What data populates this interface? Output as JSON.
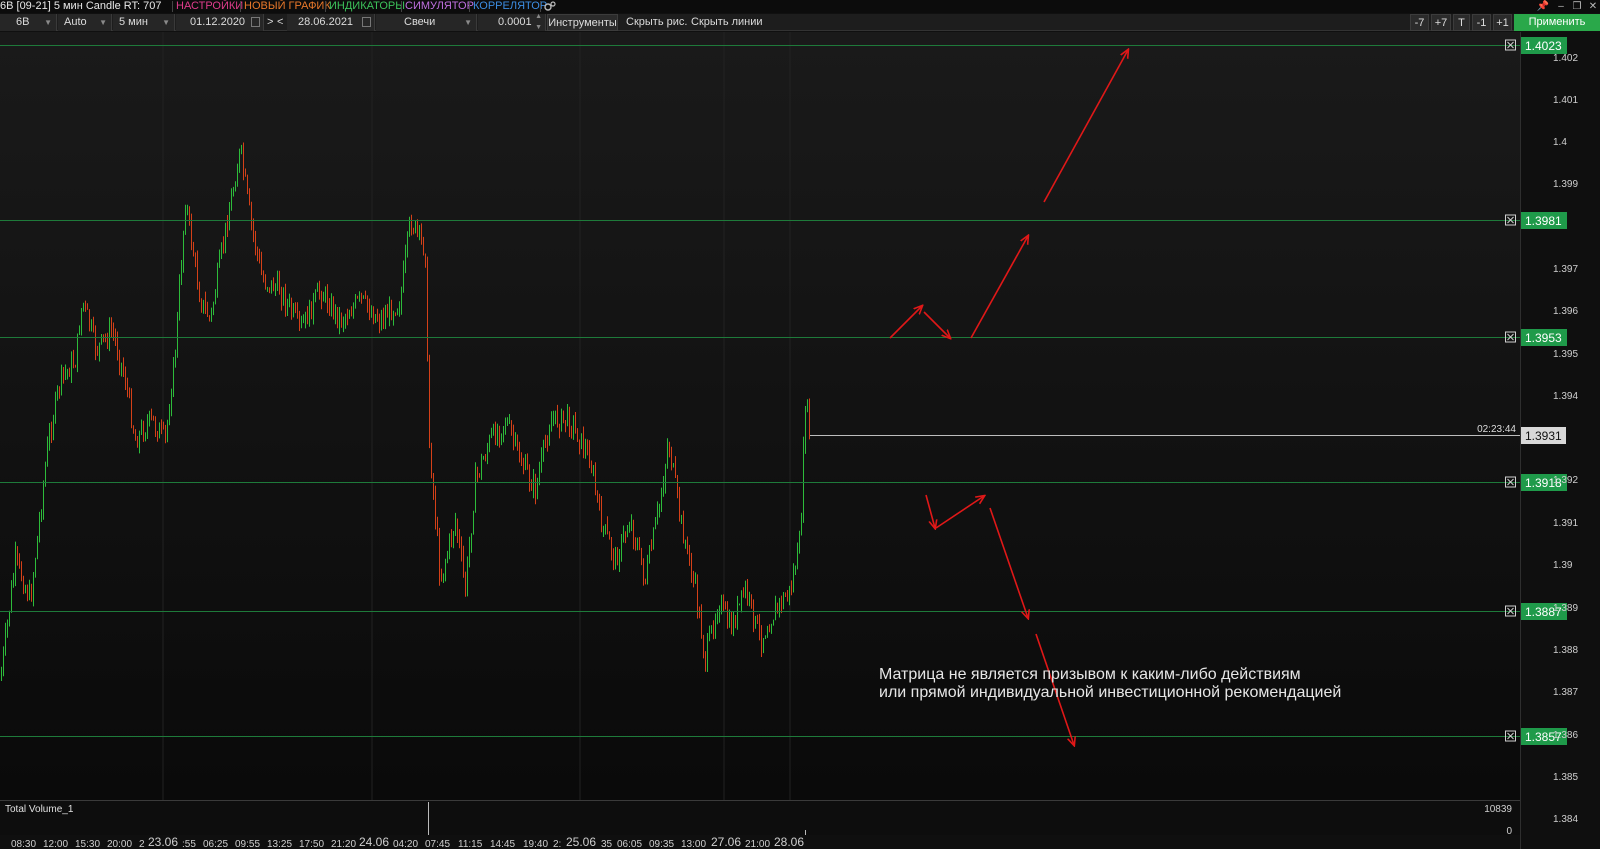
{
  "window": {
    "title": "6B [09-21] 5 мин Candle RT: 707",
    "menu": [
      {
        "label": "НАСТРОЙКИ",
        "color": "#e03c8c"
      },
      {
        "label": "НОВЫЙ ГРАФИК",
        "color": "#e8782a"
      },
      {
        "label": "ИНДИКАТОРЫ",
        "color": "#3cc05a"
      },
      {
        "label": "СИМУЛЯТОР",
        "color": "#c070e0"
      },
      {
        "label": "КОРРЕЛЯТОР",
        "color": "#3c8ce0"
      }
    ],
    "settings_icon": "gear-icon"
  },
  "toolbar": {
    "symbol": "6B",
    "mode": "Auto",
    "timeframe": "5 мин",
    "date_from": "01.12.2020",
    "nav_next": ">",
    "nav_prev": "<",
    "date_to": "28.06.2021",
    "chart_type": "Свечи",
    "step": "0.0001",
    "tools_label": "Инструменты",
    "hide_drawings_label": "Скрыть рис.",
    "hide_lines_label": "Скрыть линии",
    "shift_buttons": [
      "-7",
      "+7",
      "T",
      "-1",
      "+1"
    ],
    "apply_label": "Применить"
  },
  "chart": {
    "colors": {
      "bull": "#2dbb3a",
      "bear": "#d44018",
      "level_line": "#1e7a3a",
      "level_badge": "#1f9a4a",
      "arrow": "#e01818"
    },
    "price_ticks": [
      "1.402",
      "1.401",
      "1.4",
      "1.399",
      "1.397",
      "1.396",
      "1.395",
      "1.394",
      "1.392",
      "1.391",
      "1.39",
      "1.389",
      "1.388",
      "1.387",
      "1.386",
      "1.385",
      "1.384"
    ],
    "levels": [
      "1.4023",
      "1.3981",
      "1.3953",
      "1.3918",
      "1.3887",
      "1.3857"
    ],
    "current_price": "1.3931",
    "countdown": "02:23:44",
    "disclaimer_line1": "Матрица не является призывом к каким-либо действиям",
    "disclaimer_line2": "или прямой индивидуальной инвестиционной рекомендацией",
    "volume_label": "Total Volume_1",
    "volume_max": "10839",
    "volume_min": "0",
    "time_labels": [
      "08:30",
      "12:00",
      "15:30",
      "20:00",
      "2",
      "23.06",
      ":55",
      "06:25",
      "09:55",
      "13:25",
      "17:50",
      "21:20",
      "24.06",
      "04:20",
      "07:45",
      "11:15",
      "14:45",
      "19:40",
      "2:",
      "25.06",
      "35",
      "06:05",
      "09:35",
      "13:00",
      "27.06",
      "21:00",
      "28.06"
    ]
  }
}
